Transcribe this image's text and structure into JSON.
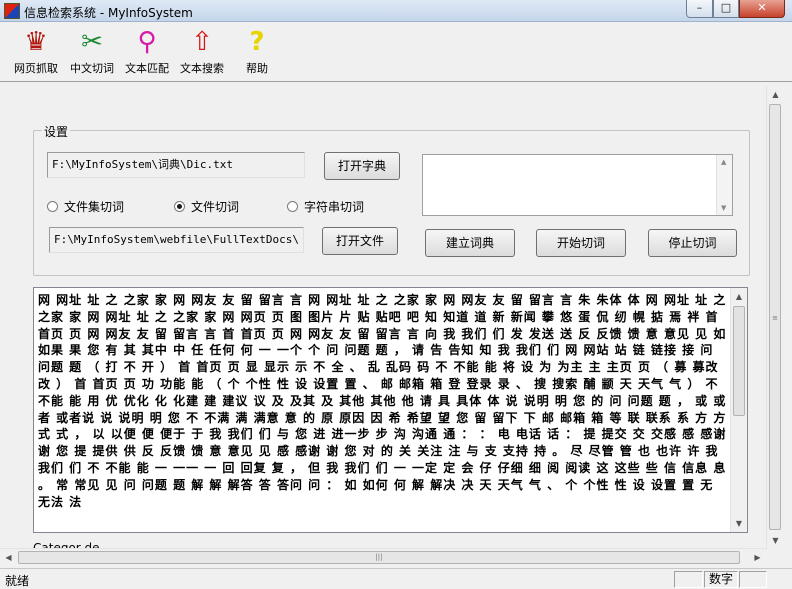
{
  "window": {
    "title": "信息检索系统 - MyInfoSystem",
    "controls": {
      "minimize": "–",
      "maximize": "□",
      "close": "✕"
    }
  },
  "toolbar": {
    "items": [
      {
        "label": "网页抓取",
        "icon": "crown-hand-icon",
        "glyph": "♛",
        "color": "#b3160c"
      },
      {
        "label": "中文切词",
        "icon": "scissors-icon",
        "glyph": "✂",
        "color": "#1d8a32"
      },
      {
        "label": "文本匹配",
        "icon": "magic-wand-icon",
        "glyph": "⚲",
        "color": "#d81aa8"
      },
      {
        "label": "文本搜索",
        "icon": "house-arrow-icon",
        "glyph": "⇧",
        "color": "#d01a1a"
      },
      {
        "label": "帮助",
        "icon": "question-icon",
        "glyph": "?",
        "color": "#e8d400"
      }
    ]
  },
  "settings": {
    "group_title": "设置",
    "dict_path": "F:\\MyInfoSystem\\词典\\Dic.txt",
    "open_dict_label": "打开字典",
    "radios": [
      {
        "label": "文件集切词",
        "checked": false
      },
      {
        "label": "文件切词",
        "checked": true
      },
      {
        "label": "字符串切词",
        "checked": false
      }
    ],
    "file_path": "F:\\MyInfoSystem\\webfile\\FullTextDocs\\",
    "open_file_label": "打开文件",
    "build_dict_label": "建立词典",
    "start_label": "开始切词",
    "stop_label": "停止切词"
  },
  "output": {
    "text": "网 网址 址 之 之家 家 网 网友 友 留 留言 言 网 网址 址 之 之家 家 网 网友 友 留 留言 言 朱 朱体 体 网 网址 址 之 之家 家 网 网址 址 之 之家 家 网 网页 页 图 图片 片 贴 贴吧 吧 知 知道 道 新 新闻 攀 悠 蛋 侃 纫 幌 掂 焉 袢 首 首页 页 网 网友 友 留 留言 言 首 首页 页 网 网友 友 留 留言 言 向 我 我们 们 发 发送 送 反 反馈 馈 意 意见 见 如 如果 果 您 有 其 其中 中 任 任何 何 一 一个 个 问 问题 题 ， 请 告 告知 知 我 我们 们 网 网站 站 链 链接 接 问 问题 题 （ 打 不 开 ） 首 首页 页 显 显示 示 不 全 、 乱 乱码 码 不 不能 能 将 设 为 为主 主 主页 页 （ 募 募改 改 ） 首 首页 页 功 功能 能 （ 个 个性 性 设 设置 置 、 邮 邮箱 箱 登 登录 录 、 搜 搜索 酺 颛 天 天气 气 ） 不 不能 能 用 优 优化 化 化建 建 建议 议 及 及其 及 其他 其他 他 请 具 具体 体 说 说明 明 您 的 问 问题 题 ， 或 或者 或者说 说 说明 明 您 不 不满 满 满意 意 的 原 原因 因 希 希望 望 您 留 留下 下 邮 邮箱 箱 等 联 联系 系 方 方式 式 ， 以 以便 便 便于 于 我 我们 们 与 您 进 进一步 步 沟 沟通 通 ： ： 电 电话 话 ： 提 提交 交 交感 感 感谢 谢 您 提 提供 供 反 反馈 馈 意 意见 见 感 感谢 谢 您 对 的 关 关注 注 与 支 支持 持 。 尽 尽管 管 也 也许 许 我 我们 们 不 不能 能 一 一一 一 回 回复 复 ， 但 我 我们 们 一 一定 定 会 仔 仔细 细 阅 阅读 这 这些 些 信 信息 息 。 常 常见 见 问 问题 题 解 解 解答 答 答问 问 ： 如 如何 何 解 解决 决 天 天气 气 、 个 个性 性 设 设置 置 无 无法 法",
    "ghost_label": "Categor de"
  },
  "status": {
    "text": "就绪",
    "pane_label": "数字"
  }
}
